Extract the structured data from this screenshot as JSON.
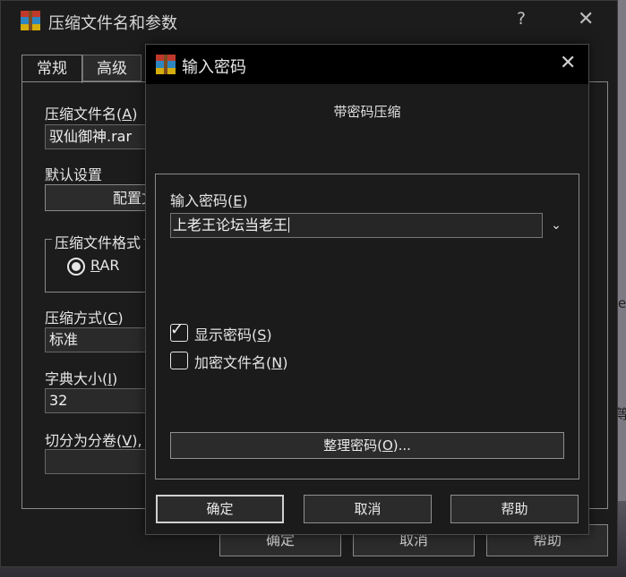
{
  "background": {
    "glyphs": [
      "e",
      "等"
    ]
  },
  "back_dialog": {
    "title": "压缩文件名和参数",
    "help_glyph": "?",
    "close_glyph": "✕",
    "tabs": [
      {
        "label": "常规"
      },
      {
        "label": "高级"
      }
    ],
    "archive_name_label": "压缩文件名(",
    "archive_name_key": "A",
    "archive_name_value": "驭仙御神.rar",
    "default_settings_label": "默认设置",
    "profiles_button_label": "配置文",
    "format_group_label": "压缩文件格式",
    "format_rar_key": "R",
    "format_rar_rest": "AR",
    "method_label": "压缩方式(",
    "method_key": "C",
    "method_value": "标准",
    "dict_label": "字典大小(",
    "dict_key": "I",
    "dict_value": "32",
    "split_label": "切分为分卷(",
    "split_key": "V",
    "split_tail": "),",
    "close_paren": ")",
    "bottom_buttons": [
      {
        "label": "确定"
      },
      {
        "label": "取消"
      },
      {
        "label": "帮助"
      }
    ]
  },
  "password_dialog": {
    "title": "输入密码",
    "close_glyph": "✕",
    "subtitle": "带密码压缩",
    "password_label": "输入密码(",
    "password_key": "E",
    "close_paren": ")",
    "password_value": "上老王论坛当老王",
    "combo_arrow": "⌄",
    "show_password_label": "显示密码(",
    "show_password_key": "S",
    "show_password_checked": true,
    "encrypt_names_label": "加密文件名(",
    "encrypt_names_key": "N",
    "encrypt_names_checked": false,
    "organize_button_label": "整理密码(",
    "organize_button_key": "O",
    "organize_button_tail": ")...",
    "ok_label": "确定",
    "cancel_label": "取消",
    "help_label": "帮助"
  }
}
